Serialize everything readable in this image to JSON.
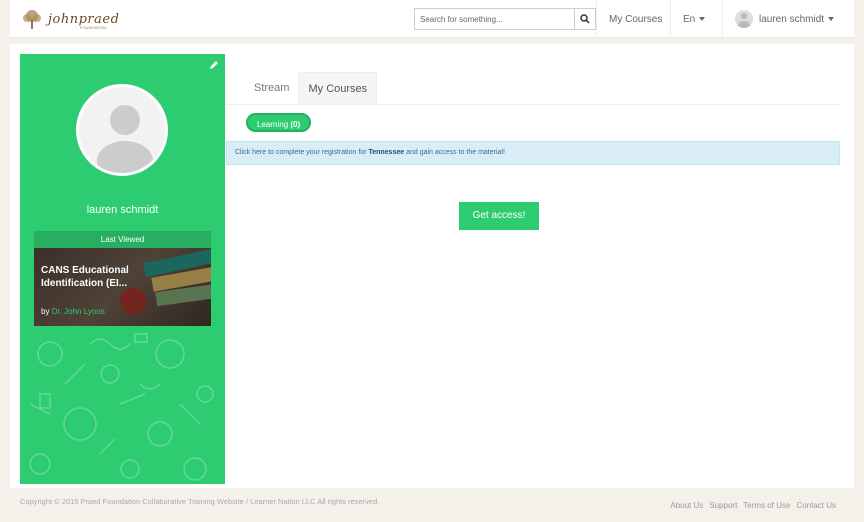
{
  "header": {
    "logo_text": "johnpraed",
    "logo_sub": "FOUNDATION",
    "search_placeholder": "Search for something...",
    "nav_courses": "My Courses",
    "language": "En",
    "user_name": "lauren schmidt"
  },
  "sidebar": {
    "profile_name": "lauren schmidt",
    "last_viewed_label": "Last Viewed",
    "course_title": "CANS Educational Identification (EI...",
    "course_by": "by",
    "course_author": "Dr. John Lyons"
  },
  "main": {
    "tabs": [
      {
        "label": "Stream"
      },
      {
        "label": "My Courses"
      }
    ],
    "filter_label": "Learning",
    "filter_count": "(0)",
    "notice_prefix": "Click here",
    "notice_mid": " to complete your registration for ",
    "notice_state": "Tennessee",
    "notice_suffix": " and gain access to the material!",
    "get_access_label": "Get access!"
  },
  "footer": {
    "copyright": "Copyright © 2015 Praed Foundation Collaborative Training Website / Learner Nation LLC All rights reserved.",
    "links": [
      "About Us",
      "Support",
      "Terms of Use",
      "Contact Us"
    ]
  },
  "colors": {
    "accent": "#2ecc71",
    "accent_dark": "#27ae60",
    "notice_bg": "#d9edf7"
  }
}
